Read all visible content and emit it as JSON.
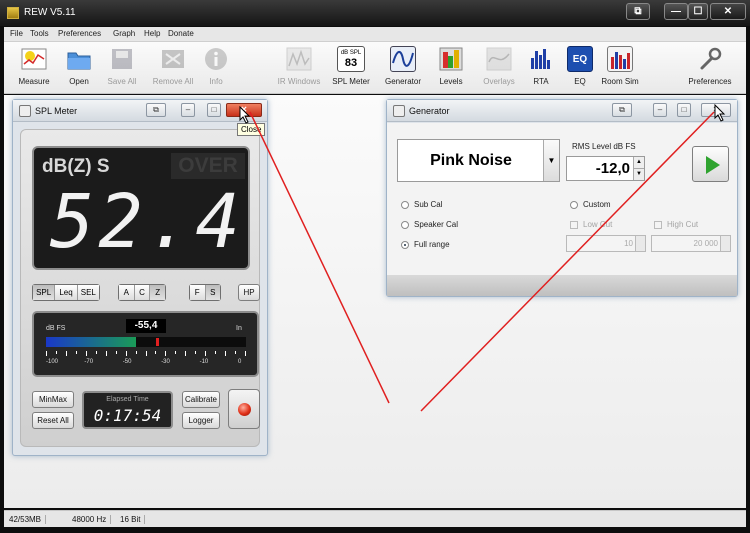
{
  "app": {
    "title": "REW V5.11"
  },
  "window_controls": {
    "restore_glyph": "⧉",
    "minimize_glyph": "—",
    "maximize_glyph": "☐",
    "close_glyph": "✕"
  },
  "menu": [
    "File",
    "Tools",
    "Preferences",
    "Graph",
    "Help",
    "Donate"
  ],
  "toolbar": {
    "items": [
      {
        "label": "Measure",
        "icon": "measure-icon",
        "enabled": true
      },
      {
        "label": "Open",
        "icon": "folder-icon",
        "enabled": true
      },
      {
        "label": "Save All",
        "icon": "save-icon",
        "enabled": false
      },
      {
        "label": "Remove All",
        "icon": "remove-icon",
        "enabled": false
      },
      {
        "label": "Info",
        "icon": "info-icon",
        "enabled": false
      },
      {
        "label": "IR Windows",
        "icon": "ir-windows-icon",
        "enabled": false
      },
      {
        "label": "SPL Meter",
        "icon": "spl-meter-icon",
        "enabled": true
      },
      {
        "label": "Generator",
        "icon": "generator-icon",
        "enabled": true
      },
      {
        "label": "Levels",
        "icon": "levels-icon",
        "enabled": true
      },
      {
        "label": "Overlays",
        "icon": "overlays-icon",
        "enabled": false
      },
      {
        "label": "RTA",
        "icon": "rta-icon",
        "enabled": true
      },
      {
        "label": "EQ",
        "icon": "eq-icon",
        "enabled": true
      },
      {
        "label": "Room Sim",
        "icon": "room-sim-icon",
        "enabled": true
      },
      {
        "label": "Preferences",
        "icon": "wrench-icon",
        "enabled": true
      }
    ],
    "spl_icon_top": "dB SPL",
    "spl_icon_value": "83",
    "eq_icon_text": "EQ"
  },
  "spl_meter": {
    "title": "SPL Meter",
    "close_glyph": "✕",
    "tooltip": "Close",
    "weighting_label": "dB(Z) S",
    "over_label": "OVER",
    "reading": "52.4",
    "measure_buttons": [
      "SPL",
      "Leq",
      "SEL"
    ],
    "weighting_buttons": [
      "A",
      "C",
      "Z"
    ],
    "speed_buttons": [
      "F",
      "S"
    ],
    "hp_button": "HP",
    "level_meter": {
      "unit_label": "dB FS",
      "value": "-55,4",
      "in_label": "In",
      "fill_fraction": 0.45,
      "peak_fraction": 0.55,
      "ticks": [
        "-100",
        "-70",
        "-50",
        "-30",
        "-10",
        "0"
      ]
    },
    "minmax_button": "MinMax",
    "reset_button": "Reset All",
    "elapsed_label": "Elapsed Time",
    "elapsed_value": "0:17:54",
    "calibrate_button": "Calibrate",
    "logger_button": "Logger"
  },
  "generator": {
    "title": "Generator",
    "signal": "Pink Noise",
    "rms_label": "RMS Level dB FS",
    "rms_value": "-12,0",
    "options": {
      "sub_cal": "Sub Cal",
      "speaker_cal": "Speaker Cal",
      "full_range": "Full range",
      "custom": "Custom",
      "low_cut": "Low Cut",
      "high_cut": "High Cut"
    },
    "low_freq": "10",
    "high_freq": "20 000"
  },
  "status": {
    "memory": "42/53MB",
    "sample_rate": "48000 Hz",
    "bit_depth": "16 Bit"
  },
  "colors": {
    "play_green": "#2fa32f",
    "meter_blue": "#1a38c8",
    "meter_green": "#1a9b57",
    "record_red": "#e03018",
    "arrow_red": "#e02020"
  }
}
